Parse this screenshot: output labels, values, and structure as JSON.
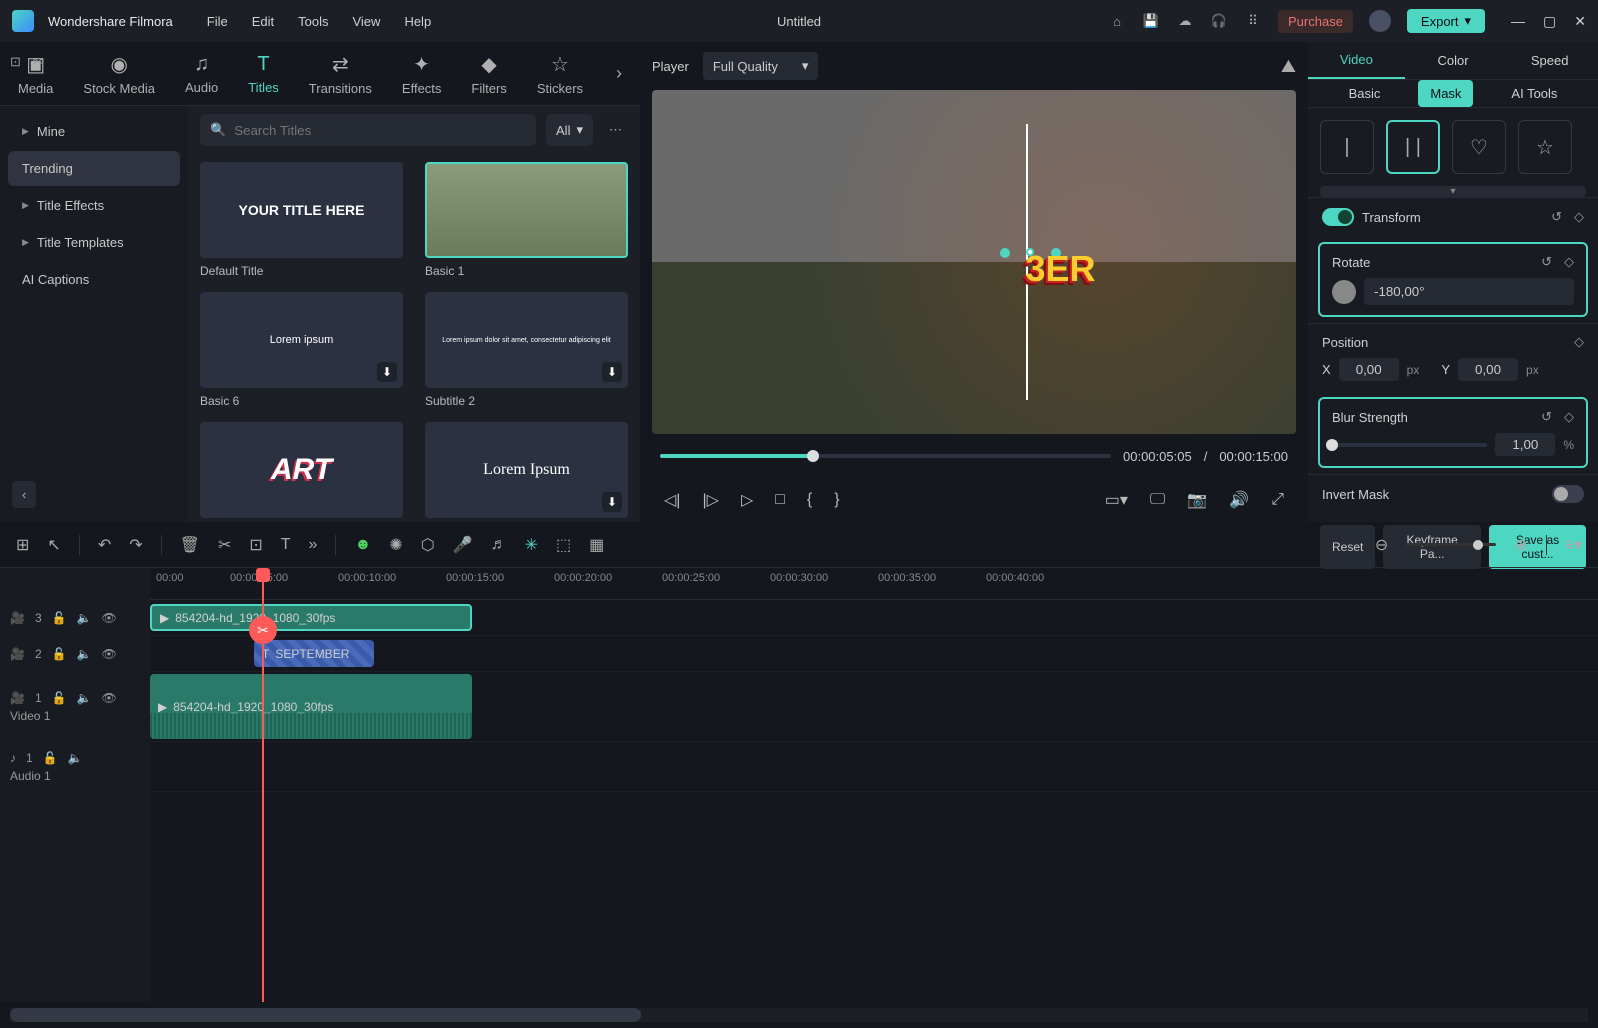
{
  "app": {
    "name": "Wondershare Filmora",
    "document": "Untitled"
  },
  "menus": [
    "File",
    "Edit",
    "Tools",
    "View",
    "Help"
  ],
  "titlebar": {
    "purchase": "Purchase",
    "export": "Export"
  },
  "topTabs": [
    {
      "label": "Media",
      "icon": "🖼"
    },
    {
      "label": "Stock Media",
      "icon": "🎞"
    },
    {
      "label": "Audio",
      "icon": "♫"
    },
    {
      "label": "Titles",
      "icon": "T",
      "active": true
    },
    {
      "label": "Transitions",
      "icon": "⇄"
    },
    {
      "label": "Effects",
      "icon": "✦"
    },
    {
      "label": "Filters",
      "icon": "⚗"
    },
    {
      "label": "Stickers",
      "icon": "☆"
    }
  ],
  "sidebar": {
    "items": [
      {
        "label": "Mine",
        "expandable": true
      },
      {
        "label": "Trending",
        "active": true
      },
      {
        "label": "Title Effects",
        "expandable": true
      },
      {
        "label": "Title Templates",
        "expandable": true
      },
      {
        "label": "AI Captions"
      }
    ]
  },
  "search": {
    "placeholder": "Search Titles",
    "filter": "All"
  },
  "thumbs": [
    {
      "label": "Default Title",
      "text": "YOUR TITLE HERE"
    },
    {
      "label": "Basic 1",
      "selected": true,
      "img": true
    },
    {
      "label": "Basic 6",
      "text": "Lorem ipsum",
      "dl": true
    },
    {
      "label": "Subtitle 2",
      "text": "Lorem ipsum dolor sit amet, consectetur adipiscing elit",
      "dl": true,
      "small": true
    },
    {
      "label": "",
      "text": "ART",
      "art": true
    },
    {
      "label": "",
      "text": "Lorem Ipsum",
      "serif": true,
      "dl": true
    }
  ],
  "player": {
    "label": "Player",
    "quality": "Full Quality",
    "overlayText": "3ER",
    "cur": "00:00:05:05",
    "dur": "00:00:15:00"
  },
  "inspector": {
    "tabs1": [
      "Video",
      "Color",
      "Speed"
    ],
    "tabs2": [
      "Basic",
      "Mask",
      "AI Tools"
    ],
    "transform": "Transform",
    "rotate": {
      "label": "Rotate",
      "value": "-180,00°"
    },
    "position": {
      "label": "Position",
      "x": "0,00",
      "y": "0,00",
      "unit": "px"
    },
    "blur": {
      "label": "Blur Strength",
      "value": "1,00",
      "unit": "%"
    },
    "invert": "Invert Mask",
    "buttons": {
      "reset": "Reset",
      "keyframe": "Keyframe Pa...",
      "save": "Save as cust..."
    }
  },
  "timeline": {
    "ticks": [
      "00:00",
      "00:00:05:00",
      "00:00:10:00",
      "00:00:15:00",
      "00:00:20:00",
      "00:00:25:00",
      "00:00:30:00",
      "00:00:35:00",
      "00:00:40:00"
    ],
    "tracks": {
      "t3": {
        "icon": "🎥",
        "num": "3"
      },
      "t2": {
        "icon": "🎥",
        "num": "2"
      },
      "t1": {
        "icon": "🎥",
        "num": "1",
        "label": "Video 1"
      },
      "a1": {
        "icon": "♪",
        "num": "1",
        "label": "Audio 1"
      }
    },
    "clips": {
      "green": "854204-hd_1920_1080_30fps",
      "blue": "SEPTEMBER",
      "video": "854204-hd_1920_1080_30fps"
    }
  }
}
